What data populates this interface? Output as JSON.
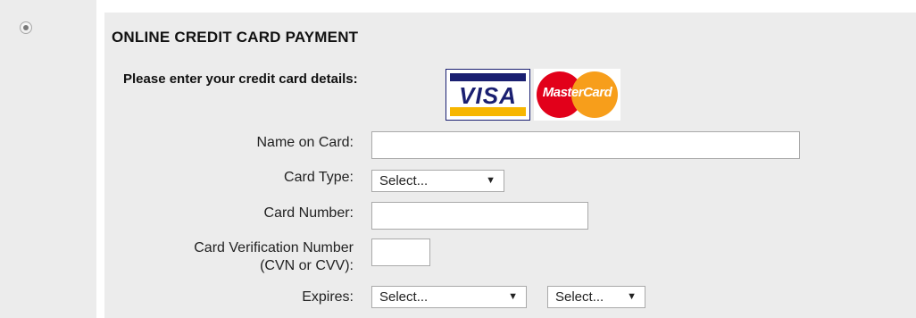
{
  "payment_option": {
    "selected": true
  },
  "section": {
    "title": "ONLINE CREDIT CARD PAYMENT",
    "intro": "Please enter your credit card details:"
  },
  "logos": {
    "visa": "VISA",
    "mastercard": "MasterCard"
  },
  "form": {
    "name_on_card": {
      "label": "Name on Card:",
      "value": ""
    },
    "card_type": {
      "label": "Card Type:",
      "selected": "Select..."
    },
    "card_number": {
      "label": "Card Number:",
      "value": ""
    },
    "cvn": {
      "label_line1": "Card Verification Number",
      "label_line2": "(CVN or CVV):",
      "value": ""
    },
    "expires": {
      "label": "Expires:",
      "month_selected": "Select...",
      "year_selected": "Select..."
    }
  },
  "colors": {
    "panel_bg": "#ececec",
    "visa_blue": "#1a1f71",
    "visa_gold": "#f7b600",
    "mc_red": "#e2001a",
    "mc_orange": "#f79e1b"
  },
  "icons": {
    "dropdown": "chevron-down-icon"
  }
}
